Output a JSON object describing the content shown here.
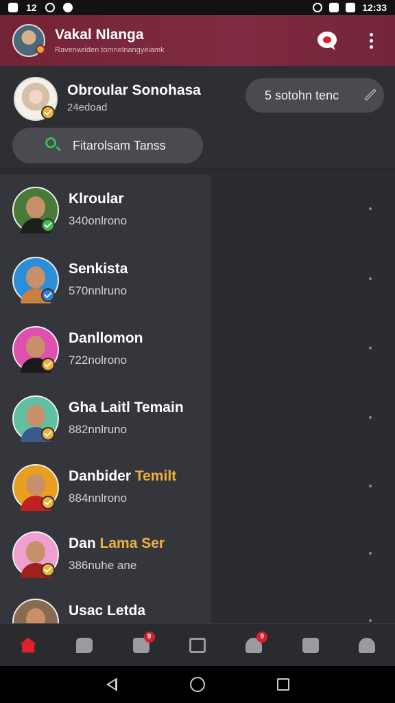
{
  "status_bar": {
    "left_icons": [
      "sim-icon",
      "messages-icon",
      "sync-icon",
      "notification-icon"
    ],
    "notification_label": "12",
    "time": "12:33"
  },
  "header": {
    "title": "Vakal Nlanga",
    "subtitle": "Ravenwriden tomnelnangyeiamk",
    "actions": [
      "chat-icon",
      "more-icon"
    ],
    "color": "#7a273c"
  },
  "profile": {
    "name": "Obroular Sonohasa",
    "status": "24edoad",
    "status_pill": "5 sotohn tenc",
    "search_placeholder": "Fitarolsam Tanss"
  },
  "contacts": [
    {
      "name": "Klroular",
      "highlight": "",
      "meta": "340onlrono",
      "badge": "green"
    },
    {
      "name": "Senkista",
      "highlight": "",
      "meta": "570nnlruno",
      "badge": "blue"
    },
    {
      "name": "Danllomon",
      "highlight": "",
      "meta": "722nolrono",
      "badge": "gold"
    },
    {
      "name": "Gha Laitl Temain",
      "highlight": "",
      "meta": "882nnlruno",
      "badge": "gold"
    },
    {
      "name": "Danbider ",
      "highlight": "Temilt",
      "meta": "884nnlrono",
      "badge": "gold"
    },
    {
      "name": "Dan ",
      "highlight": "Lama Ser",
      "meta": "386nuhe ane",
      "badge": "gold"
    },
    {
      "name": "Usac Letda",
      "highlight": "",
      "meta": "",
      "badge": ""
    }
  ],
  "bottom_nav": [
    {
      "icon": "home-icon",
      "badge": "",
      "active": true
    },
    {
      "icon": "chat-bubble-icon",
      "badge": ""
    },
    {
      "icon": "document-icon",
      "badge": "9"
    },
    {
      "icon": "lock-box-icon",
      "badge": ""
    },
    {
      "icon": "users-icon",
      "badge": "9"
    },
    {
      "icon": "briefcase-icon",
      "badge": ""
    },
    {
      "icon": "profile-icon",
      "badge": ""
    }
  ],
  "system_nav": [
    "back-icon",
    "home-circle-icon",
    "recents-icon"
  ]
}
